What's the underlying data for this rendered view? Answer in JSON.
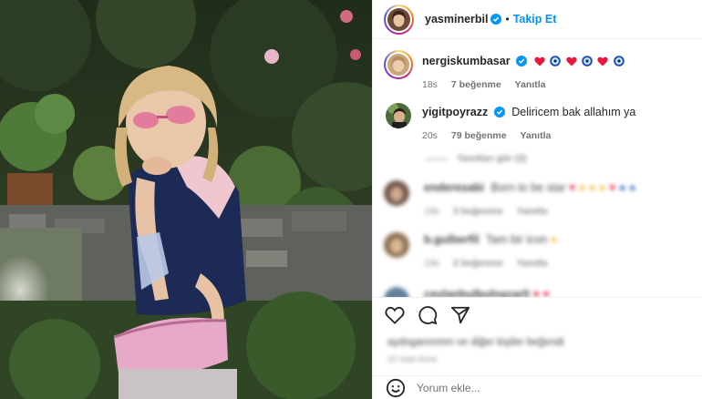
{
  "post": {
    "author": "yasminerbil",
    "follow_label": "Takip Et",
    "separator": "•"
  },
  "comments": [
    {
      "username": "nergiskumbasar",
      "text": "",
      "emojis": [
        "red-heart",
        "nazar-amulet",
        "red-heart",
        "nazar-amulet",
        "red-heart",
        "nazar-amulet"
      ],
      "time": "18s",
      "likes": "7 beğenme",
      "reply": "Yanıtla",
      "verified": true
    },
    {
      "username": "yigitpoyrazz",
      "text": "Deliricem bak allahım ya",
      "time": "20s",
      "likes": "79 beğenme",
      "reply": "Yanıtla",
      "verified": true
    }
  ],
  "blurred": {
    "view_replies": "Yanıtları gör (3)",
    "comment3": {
      "username": "enderesabi",
      "text": "Born to be star",
      "time": "19s",
      "likes": "3 beğenme",
      "reply": "Yanıtla"
    },
    "comment4": {
      "username": "b.gulberfil",
      "text": "Tam bir icon",
      "time": "19s",
      "likes": "2 beğenme",
      "reply": "Yanıtla"
    },
    "comment5": {
      "username": "ceylanbulbulnazarli"
    },
    "liked_by": "aydoganmmm ve diğer kişiler beğendi",
    "time_ago": "10 saat önce"
  },
  "comment_input": {
    "placeholder": "Yorum ekle..."
  },
  "icons": {
    "actions": [
      "heart-icon",
      "comment-icon",
      "share-icon"
    ],
    "emoji": "smile-icon"
  },
  "colors": {
    "follow": "#0095f6",
    "verified": "#0095f6",
    "text": "#262626",
    "muted": "#737373"
  }
}
